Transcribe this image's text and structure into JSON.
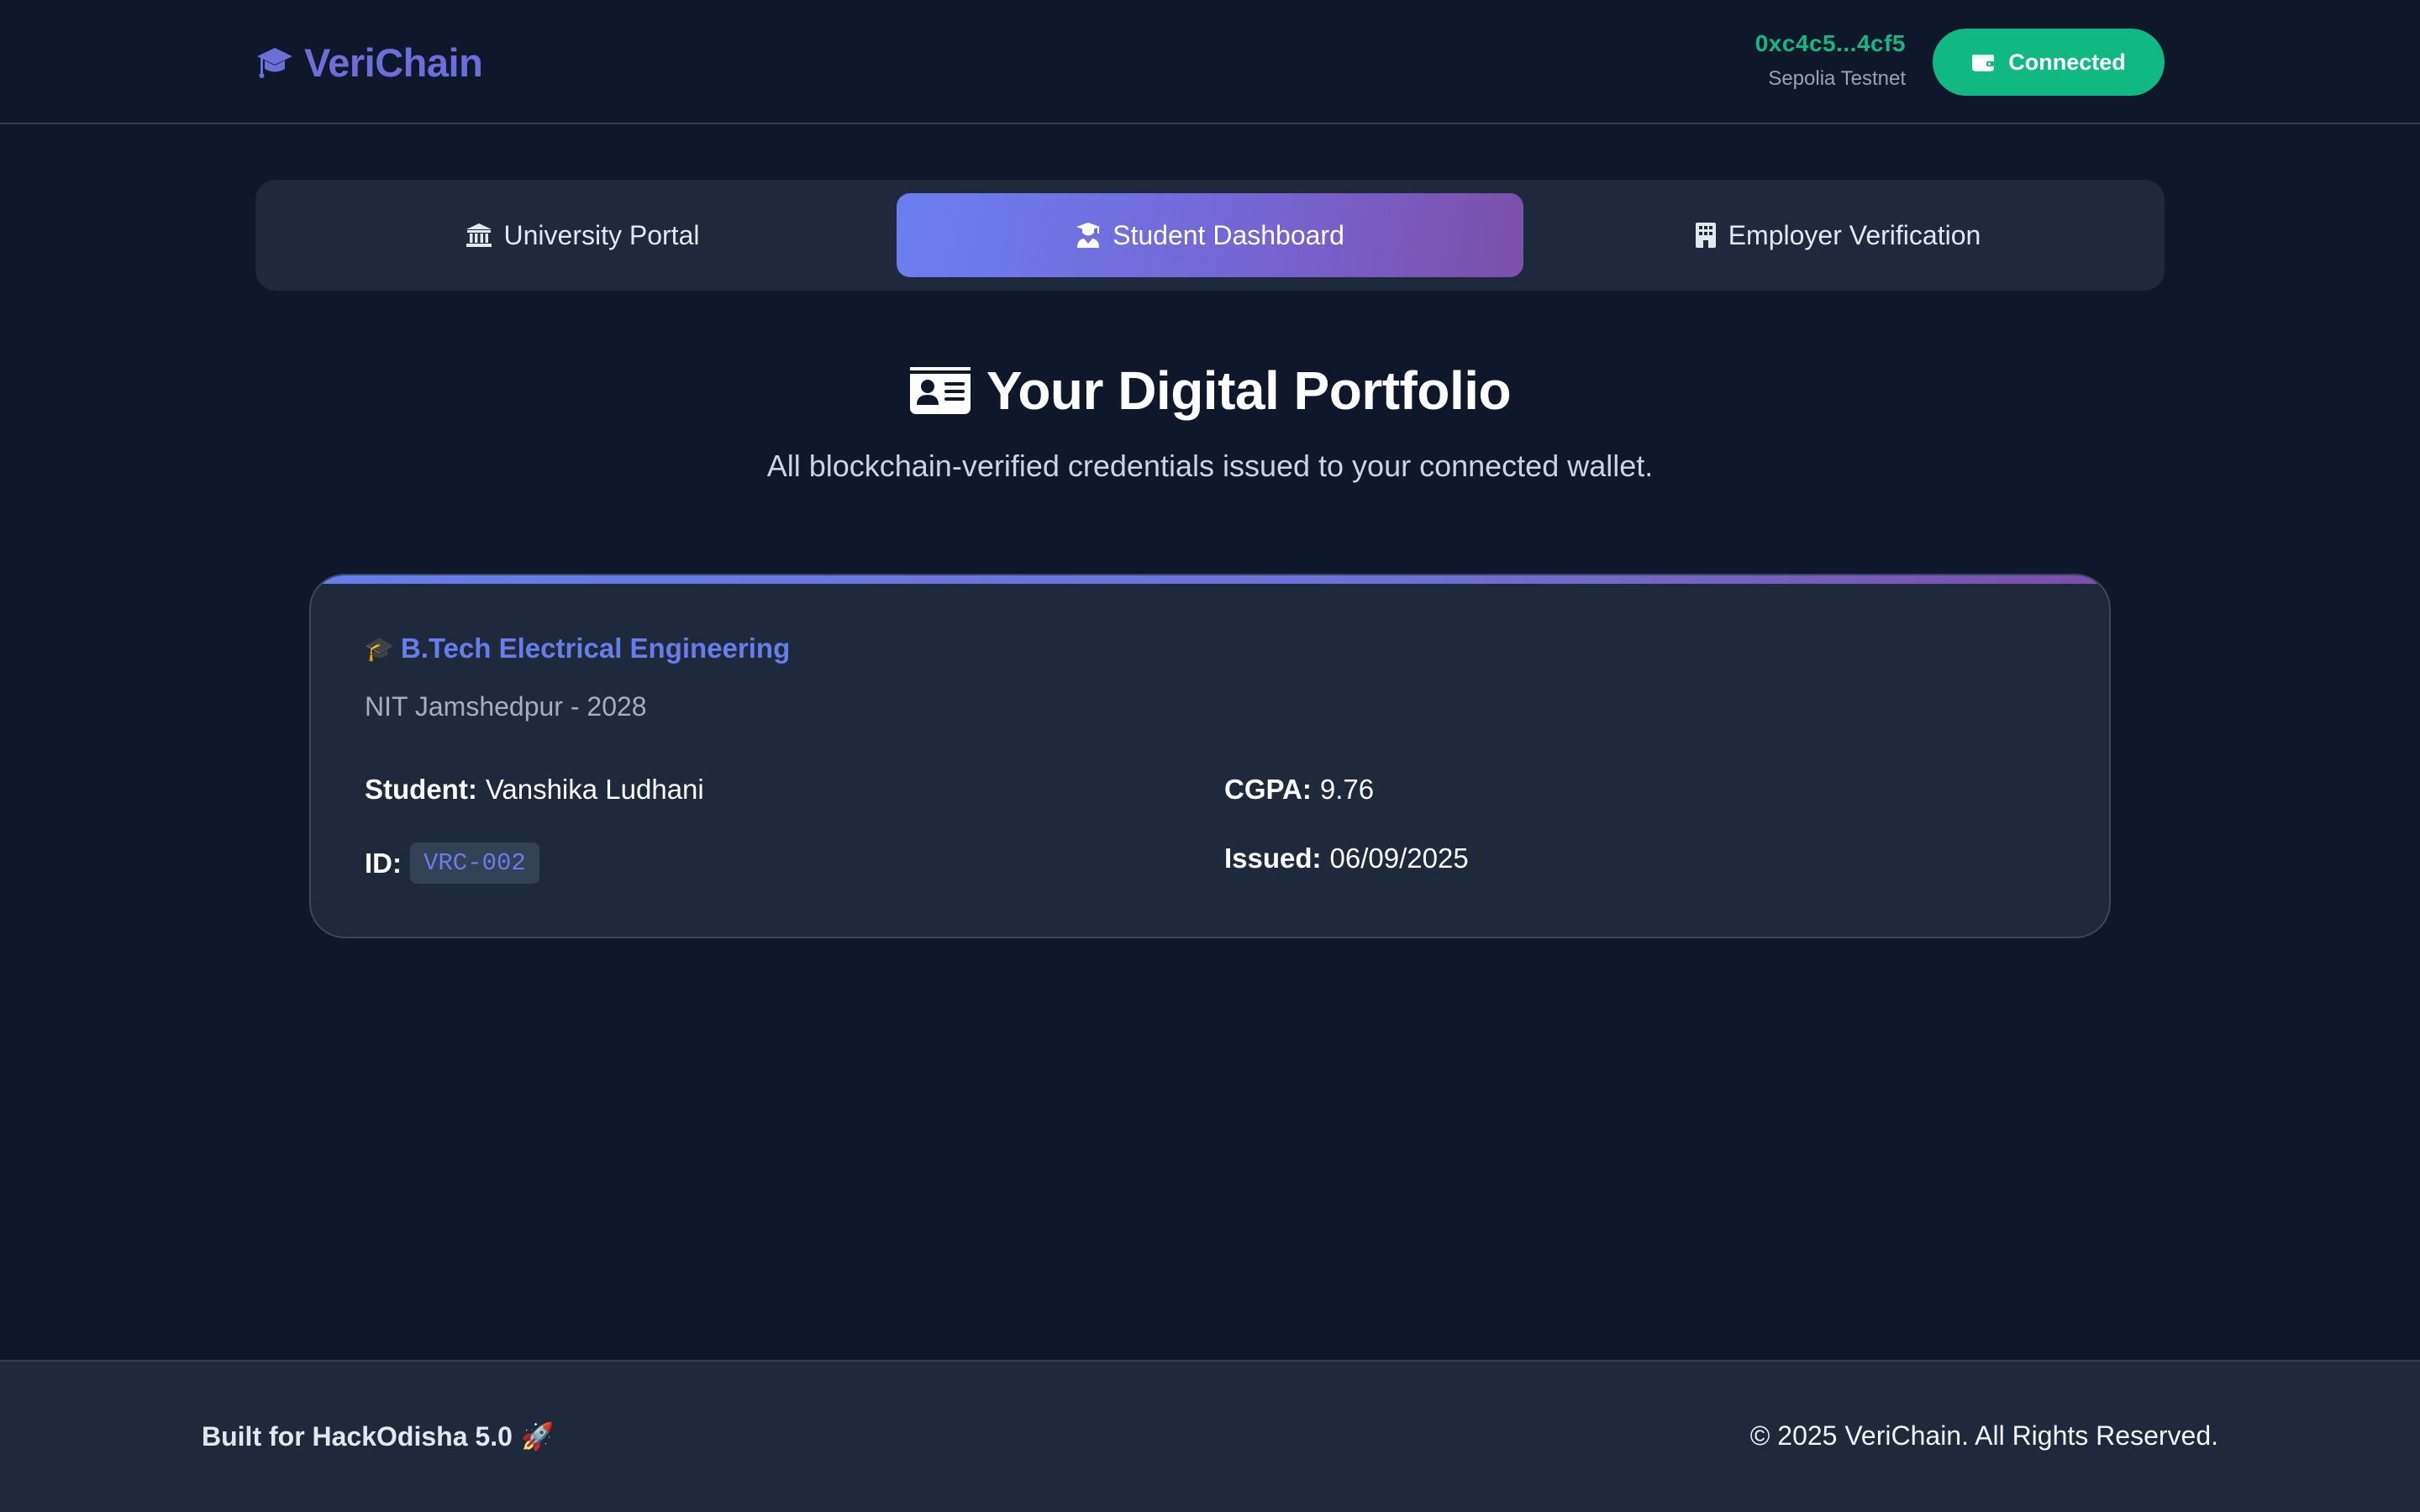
{
  "header": {
    "brand": "VeriChain",
    "brand_color": "#6d6fd8",
    "brand_icon": "graduation-cap-icon",
    "wallet_address": "0xc4c5...4cf5",
    "network": "Sepolia Testnet",
    "connect_label": "Connected",
    "connect_icon": "wallet-icon",
    "connect_color": "#10b981"
  },
  "tabs": [
    {
      "label": "University Portal",
      "icon": "university-icon",
      "active": false
    },
    {
      "label": "Student Dashboard",
      "icon": "graduate-icon",
      "active": true
    },
    {
      "label": "Employer Verification",
      "icon": "building-icon",
      "active": false
    }
  ],
  "main": {
    "title": "Your Digital Portfolio",
    "title_icon": "id-card-icon",
    "subtitle": "All blockchain-verified credentials issued to your connected wallet."
  },
  "credential": {
    "emoji": "🎓",
    "degree": "B.Tech Electrical Engineering",
    "institution_year": "NIT Jamshedpur - 2028",
    "student_label": "Student:",
    "student_name": "Vanshika Ludhani",
    "cgpa_label": "CGPA:",
    "cgpa": "9.76",
    "id_label": "ID:",
    "id": "VRC-002",
    "issued_label": "Issued:",
    "issued": "06/09/2025",
    "accent_color": "#667eea"
  },
  "footer": {
    "left": "Built for HackOdisha 5.0",
    "left_emoji": "🚀",
    "right": "© 2025 VeriChain. All Rights Reserved."
  }
}
